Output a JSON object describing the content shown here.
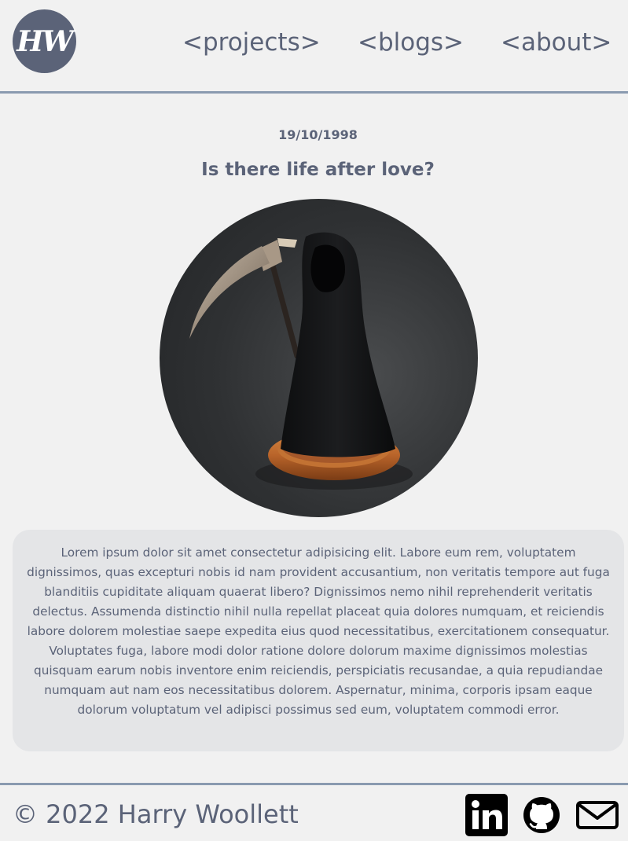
{
  "header": {
    "logo_text": "HW",
    "nav": {
      "projects": "<projects>",
      "blogs": "<blogs>",
      "about": "<about>"
    }
  },
  "post": {
    "date": "19/10/1998",
    "title": "Is there life after love?",
    "image_alt": "grim-reaper-figurine",
    "body": "Lorem ipsum dolor sit amet consectetur adipisicing elit. Labore eum rem, voluptatem dignissimos, quas excepturi nobis id nam provident accusantium, non veritatis tempore aut fuga blanditiis cupiditate aliquam quaerat libero? Dignissimos nemo nihil reprehenderit veritatis delectus. Assumenda distinctio nihil nulla repellat placeat quia dolores numquam, et reiciendis labore dolorem molestiae saepe expedita eius quod necessitatibus, exercitationem consequatur. Voluptates fuga, labore modi dolor ratione dolore dolorum maxime dignissimos molestias quisquam earum nobis inventore enim reiciendis, perspiciatis recusandae, a quia repudiandae numquam aut nam eos necessitatibus dolorem. Aspernatur, minima, corporis ipsam eaque dolorum voluptatum vel adipisci possimus sed eum, voluptatem commodi error."
  },
  "footer": {
    "copyright": "© 2022 Harry Woollett",
    "social": [
      {
        "icon": "linkedin-icon"
      },
      {
        "icon": "github-icon"
      },
      {
        "icon": "mail-icon"
      }
    ]
  },
  "colors": {
    "background": "#f1f1f1",
    "text": "#5b6378",
    "divider": "#8a9ab0",
    "body_panel": "#e4e5e7"
  }
}
